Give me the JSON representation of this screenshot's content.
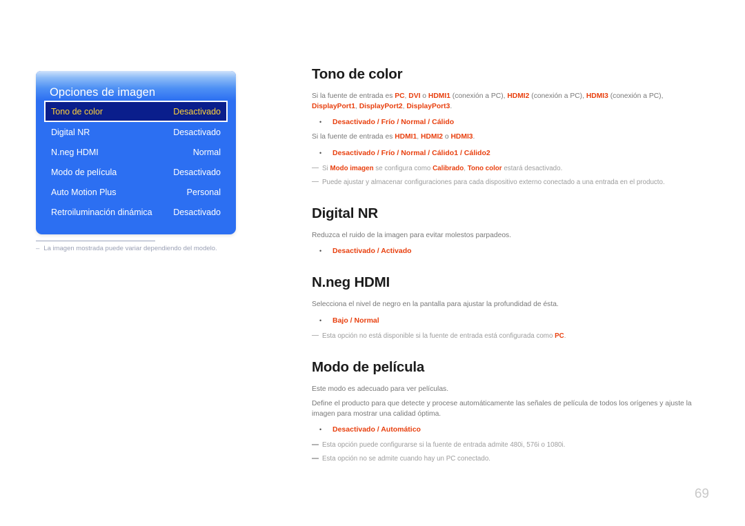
{
  "osd": {
    "title": "Opciones de imagen",
    "rows": [
      {
        "label": "Tono de color",
        "value": "Desactivado",
        "selected": true
      },
      {
        "label": "Digital NR",
        "value": "Desactivado",
        "selected": false
      },
      {
        "label": "N.neg HDMI",
        "value": "Normal",
        "selected": false
      },
      {
        "label": "Modo de película",
        "value": "Desactivado",
        "selected": false
      },
      {
        "label": "Auto Motion Plus",
        "value": "Personal",
        "selected": false
      },
      {
        "label": "Retroiluminación dinámica",
        "value": "Desactivado",
        "selected": false
      }
    ],
    "footnote_dash": "–",
    "footnote": "La imagen mostrada puede variar dependiendo del modelo."
  },
  "sections": {
    "tono": {
      "title": "Tono de color",
      "p1_a": "Si la fuente de entrada es ",
      "p1_pc": "PC",
      "p1_c1": ", ",
      "p1_dvi": "DVI",
      "p1_c2": " o ",
      "p1_hdmi1": "HDMI1",
      "p1_c3": " (conexión a PC), ",
      "p1_hdmi2": "HDMI2",
      "p1_c4": " (conexión a PC), ",
      "p1_hdmi3": "HDMI3",
      "p1_c5": " (conexión a PC), ",
      "p1_dp1": "DisplayPort1",
      "p1_c6": ", ",
      "p1_dp2": "DisplayPort2",
      "p1_c7": ", ",
      "p1_dp3": "DisplayPort3",
      "p1_end": ".",
      "opt1": "Desactivado / Frío / Normal / Cálido",
      "p2_a": "Si la fuente de entrada es ",
      "p2_h1": "HDMI1",
      "p2_c1": ", ",
      "p2_h2": "HDMI2",
      "p2_c2": " o ",
      "p2_h3": "HDMI3",
      "p2_end": ".",
      "opt2": "Desactivado / Frío / Normal / Cálido1 / Cálido2",
      "note1_a": "Si ",
      "note1_kw1": "Modo imagen",
      "note1_b": " se configura como ",
      "note1_kw2": "Calibrado",
      "note1_c": ", ",
      "note1_kw3": "Tono color",
      "note1_d": " estará desactivado.",
      "note2": "Puede ajustar y almacenar configuraciones para cada dispositivo externo conectado a una entrada en el producto."
    },
    "digitalnr": {
      "title": "Digital NR",
      "p1": "Reduzca el ruido de la imagen para evitar molestos parpadeos.",
      "opt1": "Desactivado / Activado"
    },
    "nneg": {
      "title": "N.neg HDMI",
      "p1": "Selecciona el nivel de negro en la pantalla para ajustar la profundidad de ésta.",
      "opt1": "Bajo / Normal",
      "note1_a": "Esta opción no está disponible si la fuente de entrada está configurada como ",
      "note1_kw": "PC",
      "note1_b": "."
    },
    "modo": {
      "title": "Modo de película",
      "p1": "Este modo es adecuado para ver películas.",
      "p2": "Define el producto para que detecte y procese automáticamente las señales de película de todos los orígenes y ajuste la imagen para mostrar una calidad óptima.",
      "opt1": "Desactivado / Automático",
      "note1": "Esta opción puede configurarse si la fuente de entrada admite 480i, 576i o 1080i.",
      "note2": "Esta opción no se admite cuando hay un PC conectado."
    }
  },
  "page_number": "69",
  "colors": {
    "osd_blue": "#2c6ff2",
    "osd_selected_bg": "#0a1e8c",
    "osd_selected_text": "#ffd23a",
    "keyword_red": "#e8400f",
    "body_gray": "#787878",
    "note_gray": "#9d9d9d"
  }
}
